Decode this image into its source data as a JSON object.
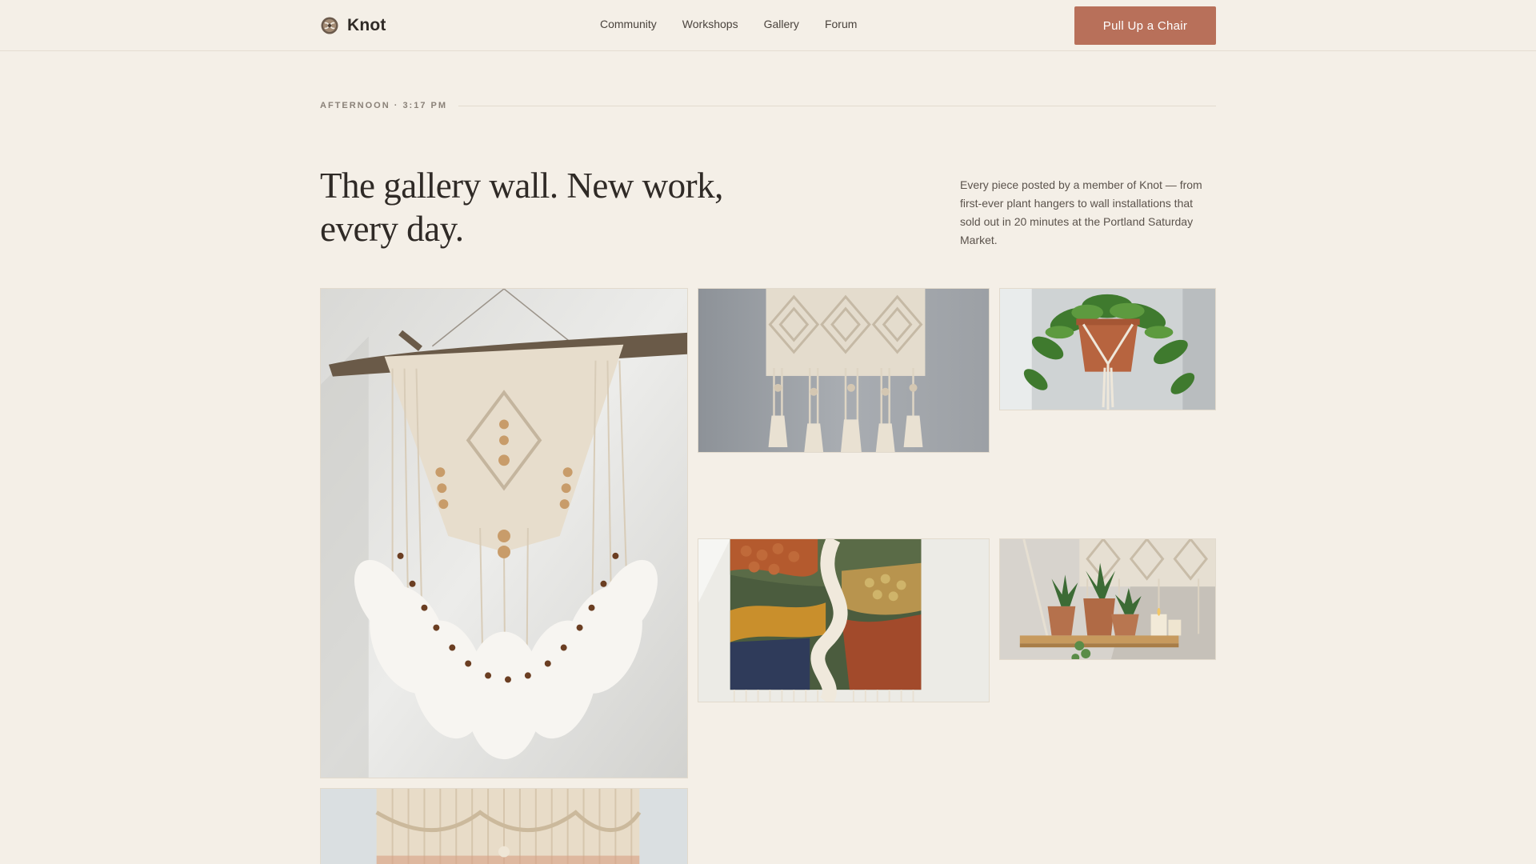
{
  "brand": {
    "name": "Knot",
    "icon": "knot-logo-icon"
  },
  "nav": {
    "items": [
      "Community",
      "Workshops",
      "Gallery",
      "Forum"
    ]
  },
  "cta": {
    "label": "Pull Up a Chair"
  },
  "colors": {
    "background": "#f4efe7",
    "accent": "#b8705a",
    "text": "#2f2a26"
  },
  "timestamp": "AFTERNOON · 3:17 PM",
  "hero": {
    "title": "The gallery wall. New work, every day.",
    "intro": "Every piece posted by a member of Knot — from first-ever plant hangers to wall installations that sold out in 20 minutes at the Portland Saturday Market."
  },
  "gallery": {
    "items": [
      {
        "subject": "driftwood macrame wall hanging with feathers"
      },
      {
        "subject": "macrame diamond pattern panel with tassels"
      },
      {
        "subject": "potted pothos in macrame plant hanger"
      },
      {
        "subject": "textured woven wall tapestry"
      },
      {
        "subject": "macrame hanging shelf with succulents"
      },
      {
        "subject": "dip-dyed macrame wall hanging"
      }
    ]
  }
}
